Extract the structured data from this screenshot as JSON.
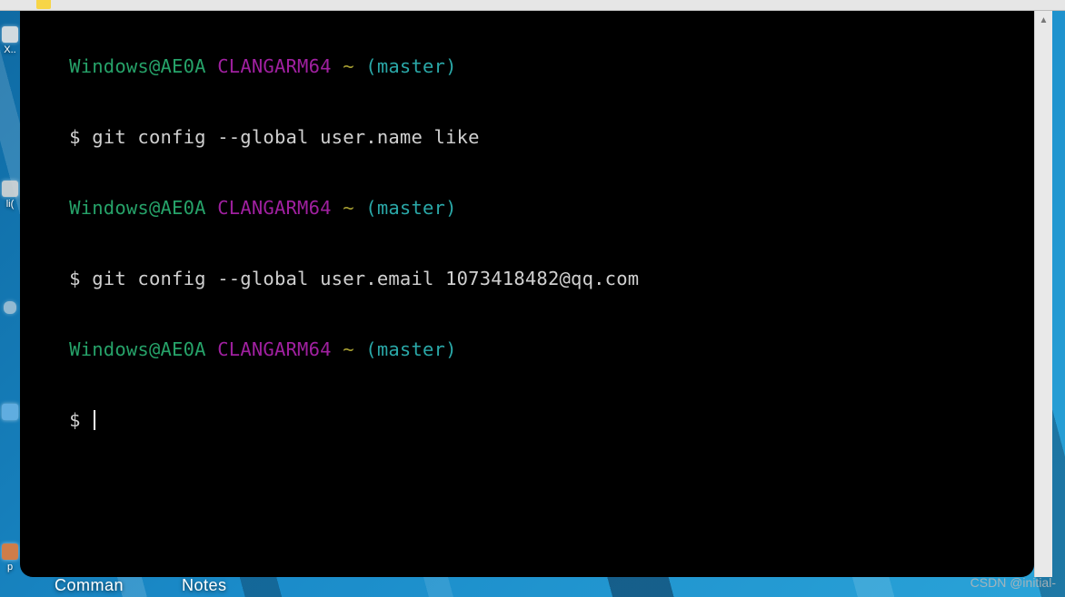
{
  "colors": {
    "user_host": "#26a269",
    "env": "#a020a0",
    "tilde": "#a8a032",
    "branch": "#2aa8a8",
    "text": "#d0d0d0",
    "bg_terminal": "#000000"
  },
  "desktop": {
    "left_icons": {
      "xw": "X..",
      "li": "li(",
      "pp": "p"
    },
    "taskbar": {
      "icon1_label": "Comman",
      "icon2_label": "Notes"
    }
  },
  "terminal": {
    "prompts": [
      {
        "user": "Windows",
        "at": "@",
        "host": "AE0A",
        "env": "CLANGARM64",
        "tilde": "~",
        "branch": "(master)",
        "symbol": "$",
        "command": "git config --global user.name like"
      },
      {
        "user": "Windows",
        "at": "@",
        "host": "AE0A",
        "env": "CLANGARM64",
        "tilde": "~",
        "branch": "(master)",
        "symbol": "$",
        "command": "git config --global user.email 1073418482@qq.com"
      },
      {
        "user": "Windows",
        "at": "@",
        "host": "AE0A",
        "env": "CLANGARM64",
        "tilde": "~",
        "branch": "(master)",
        "symbol": "$",
        "command": ""
      }
    ],
    "blank_line": ""
  },
  "watermark": "CSDN @initial-"
}
